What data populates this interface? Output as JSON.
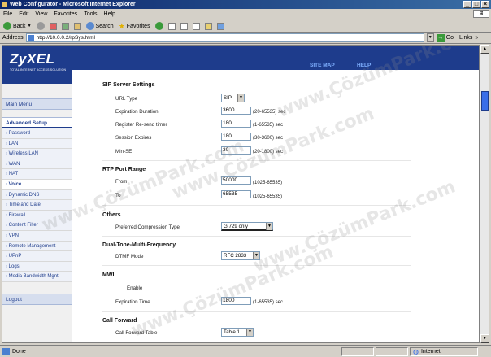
{
  "window": {
    "title": "Web Configurator - Microsoft Internet Explorer",
    "min": "_",
    "max": "□",
    "close": "×"
  },
  "menubar": [
    "File",
    "Edit",
    "View",
    "Favorites",
    "Tools",
    "Help"
  ],
  "toolbar": {
    "back": "Back",
    "search": "Search",
    "favorites": "Favorites"
  },
  "addressbar": {
    "label": "Address",
    "url": "http://10.0.0.2/rpSys.html",
    "go": "Go",
    "links": "Links"
  },
  "sidebar": {
    "logo": "ZyXEL",
    "tagline": "TOTAL INTERNET ACCESS SOLUTION",
    "main_menu": "Main Menu",
    "advanced": "Advanced Setup",
    "items": [
      "Password",
      "LAN",
      "Wireless LAN",
      "WAN",
      "NAT",
      "Voice",
      "Dynamic DNS",
      "Time and Date",
      "Firewall",
      "Content Filter",
      "VPN",
      "Remote Management",
      "UPnP",
      "Logs",
      "Media Bandwidth Mgnt"
    ],
    "logout": "Logout"
  },
  "header": {
    "site_map": "SITE MAP",
    "help": "HELP"
  },
  "sip": {
    "title": "SIP Server Settings",
    "url_type_label": "URL Type",
    "url_type": "SIP",
    "expiration_label": "Expiration Duration",
    "expiration": "3600",
    "expiration_hint": "(20-65535) sec",
    "resend_label": "Register Re-send timer",
    "resend": "180",
    "resend_hint": "(1-65535) sec",
    "session_label": "Session Expires",
    "session": "180",
    "session_hint": "(30-3600) sec",
    "minse_label": "Min-SE",
    "minse": "30",
    "minse_hint": "(20-1800) sec"
  },
  "rtp": {
    "title": "RTP Port Range",
    "from_label": "From",
    "from": "50000",
    "from_hint": "(1025-65535)",
    "to_label": "To",
    "to": "65535",
    "to_hint": "(1025-65535)"
  },
  "others": {
    "title": "Others",
    "compression_label": "Preferred Compression Type",
    "compression": "G.729 only"
  },
  "dtmf": {
    "title": "Dual-Tone-Multi-Frequency",
    "mode_label": "DTMF Mode",
    "mode": "RFC 2833"
  },
  "mwi": {
    "title": "MWI",
    "enable_label": "Enable",
    "exp_label": "Expiration Time",
    "exp": "1800",
    "exp_hint": "(1-65535) sec"
  },
  "callforward": {
    "title": "Call Forward",
    "table_label": "Call Forward Table",
    "table": "Table 1"
  },
  "status": {
    "done": "Done",
    "zone": "Internet"
  },
  "watermark": "www.ÇözümPark.com"
}
